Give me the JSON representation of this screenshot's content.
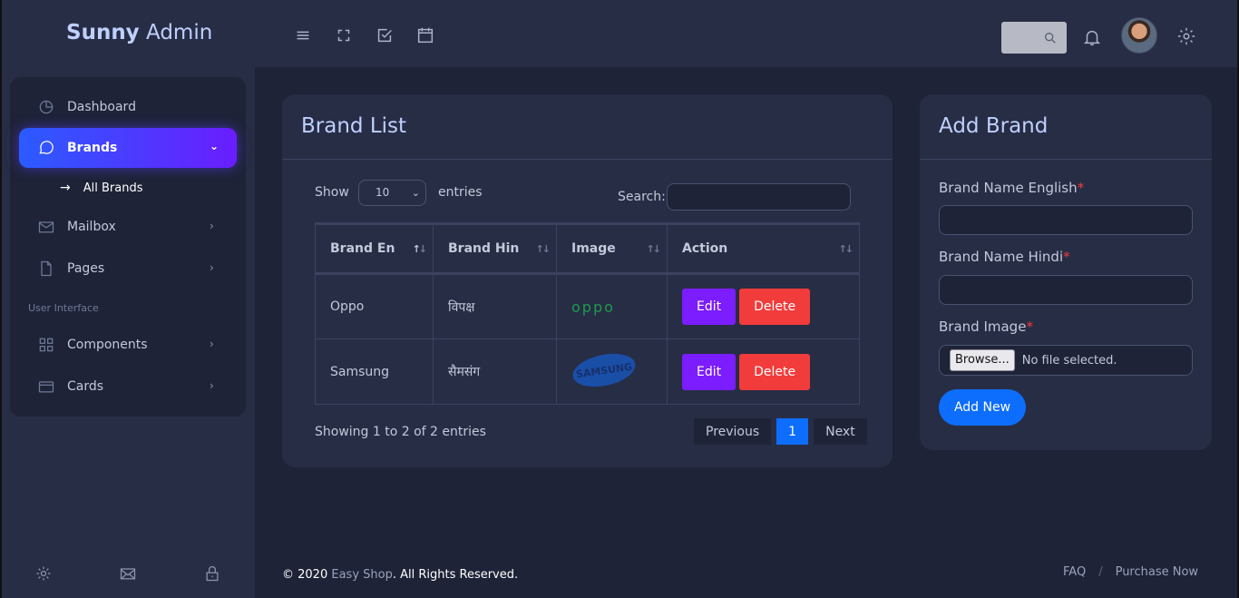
{
  "app": {
    "name_bold": "Sunny",
    "name_rest": " Admin"
  },
  "header": {
    "icons": [
      "menu-icon",
      "fullscreen-icon",
      "checkbox-icon",
      "calendar-icon"
    ],
    "search_icon": "search-icon",
    "bell_icon": "bell-icon",
    "settings_icon": "gear-icon"
  },
  "sidebar": {
    "items": [
      {
        "label": "Dashboard",
        "icon": "pie-chart-icon"
      },
      {
        "label": "Brands",
        "icon": "chat-icon",
        "active": true
      },
      {
        "label": "Mailbox",
        "icon": "mail-icon"
      },
      {
        "label": "Pages",
        "icon": "file-icon"
      },
      {
        "label": "Components",
        "icon": "grid-icon"
      },
      {
        "label": "Cards",
        "icon": "credit-card-icon"
      }
    ],
    "sub_item": "All Brands",
    "section_label": "User Interface",
    "footer_icons": [
      "gear-icon",
      "mail-icon",
      "lock-icon"
    ]
  },
  "brand_list": {
    "title": "Brand List",
    "show_label": "Show",
    "entries_value": "10",
    "entries_label": "entries",
    "search_label": "Search:",
    "columns": [
      "Brand En",
      "Brand Hin",
      "Image",
      "Action"
    ],
    "rows": [
      {
        "en": "Oppo",
        "hin": "विपक्ष",
        "image": "oppo",
        "edit": "Edit",
        "delete": "Delete"
      },
      {
        "en": "Samsung",
        "hin": "सैमसंग",
        "image": "SAMSUNG",
        "edit": "Edit",
        "delete": "Delete"
      }
    ],
    "info": "Showing 1 to 2 of 2 entries",
    "pager": {
      "previous": "Previous",
      "page": "1",
      "next": "Next"
    }
  },
  "add_brand": {
    "title": "Add Brand",
    "name_en_label": "Brand Name English",
    "name_hin_label": "Brand Name Hindi",
    "image_label": "Brand Image",
    "required_mark": "*",
    "browse_label": "Browse...",
    "file_status": "No file selected.",
    "submit_label": "Add New"
  },
  "footer": {
    "copyright_prefix": "© 2020 ",
    "company": "Easy Shop",
    "copyright_suffix": ". All Rights Reserved.",
    "links": [
      "FAQ",
      "Purchase Now"
    ],
    "separator": "/"
  }
}
